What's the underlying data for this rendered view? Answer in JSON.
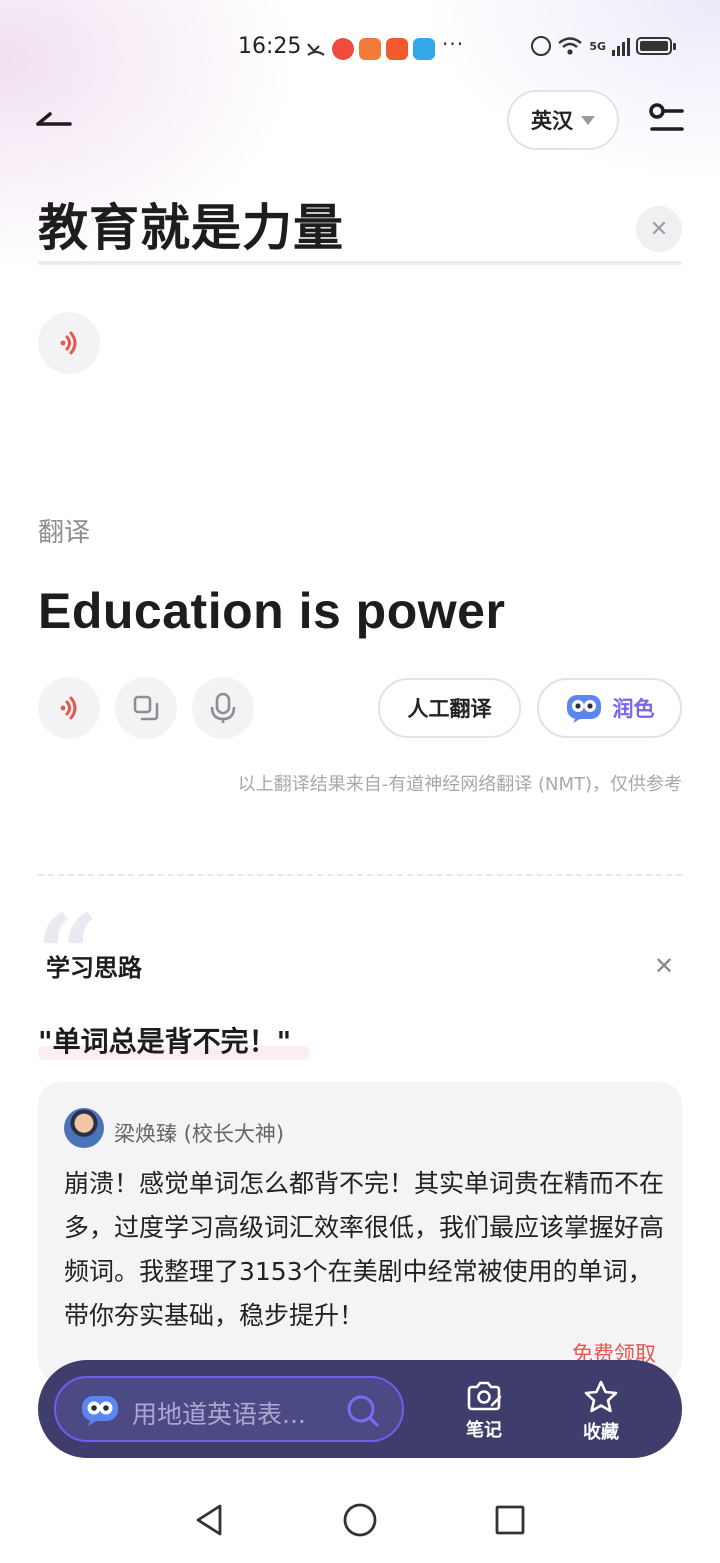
{
  "status_bar": {
    "time": "16:25",
    "network": "5G"
  },
  "header": {
    "language_label": "英汉"
  },
  "source": {
    "text": "教育就是力量",
    "clear_icon": "✕"
  },
  "translation": {
    "section_label": "翻译",
    "text": "Education is power",
    "human_translate_label": "人工翻译",
    "polish_label": "润色",
    "disclaimer": "以上翻译结果来自-有道神经网络翻译 (NMT)，仅供参考"
  },
  "study": {
    "title": "学习思路",
    "close_icon": "✕",
    "quote": "\"单词总是背不完！\"",
    "author": "梁焕臻 (校长大神)",
    "body": "崩溃！感觉单词怎么都背不完！其实单词贵在精而不在多，过度学习高级词汇效率很低，我们最应该掌握好高频词。我整理了3153个在美剧中经常被使用的单词，带你夯实基础，稳步提升！",
    "link": "免费领取"
  },
  "bottom_bar": {
    "search_placeholder": "用地道英语表...",
    "notes_label": "笔记",
    "favorites_label": "收藏"
  },
  "colors": {
    "accent_red": "#e8574e",
    "accent_purple": "#6e5df0",
    "bottom_bar_bg": "#3f3d6b"
  }
}
